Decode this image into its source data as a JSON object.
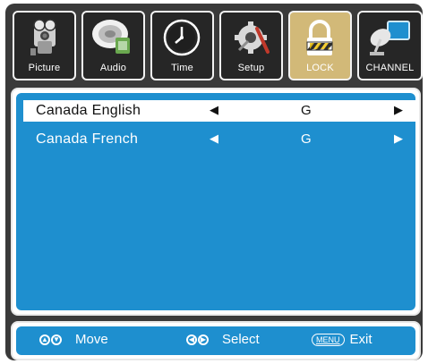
{
  "tabs": [
    {
      "label": "Picture",
      "icon": "camera-icon"
    },
    {
      "label": "Audio",
      "icon": "speaker-icon"
    },
    {
      "label": "Time",
      "icon": "clock-icon"
    },
    {
      "label": "Setup",
      "icon": "gear-tools-icon"
    },
    {
      "label": "LOCK",
      "icon": "padlock-icon",
      "active": true
    },
    {
      "label": "CHANNEL",
      "icon": "satellite-dish-icon"
    }
  ],
  "list": {
    "rows": [
      {
        "name": "Canada English",
        "value": "G",
        "selected": true
      },
      {
        "name": "Canada French",
        "value": "G",
        "selected": false
      }
    ]
  },
  "footer": {
    "move_label": "Move",
    "select_label": "Select",
    "menu_badge": "MENU",
    "exit_label": "Exit"
  },
  "colors": {
    "accent_blue": "#1e8fcf",
    "tab_active": "#d2b978",
    "frame_dark": "#3a3a3a"
  }
}
